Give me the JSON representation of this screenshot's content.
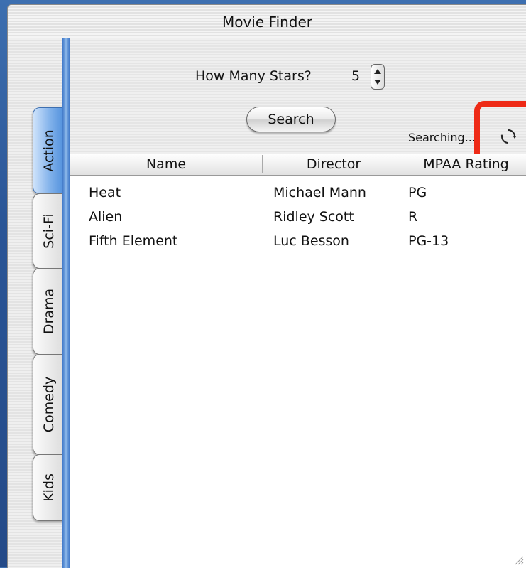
{
  "window": {
    "title": "Movie Finder"
  },
  "tabs": [
    {
      "label": "Action",
      "active": true
    },
    {
      "label": "Sci-Fi",
      "active": false
    },
    {
      "label": "Drama",
      "active": false
    },
    {
      "label": "Comedy",
      "active": false
    },
    {
      "label": "Kids",
      "active": false
    }
  ],
  "form": {
    "stars_label": "How Many Stars?",
    "stars_value": "5",
    "search_label": "Search",
    "status_text": "Searching..."
  },
  "table": {
    "columns": [
      "Name",
      "Director",
      "MPAA Rating"
    ],
    "rows": [
      [
        "Heat",
        "Michael Mann",
        "PG"
      ],
      [
        "Alien",
        "Ridley Scott",
        "R"
      ],
      [
        "Fifth Element",
        "Luc Besson",
        "PG-13"
      ]
    ]
  },
  "colors": {
    "highlight": "#ee2a16",
    "active_tab": "#7fb0ea",
    "desktop": "#2a5596"
  },
  "icons": {
    "busy": "spinner-icon",
    "resize": "resize-grip-icon",
    "stepper": "stepper-arrows-icon"
  }
}
